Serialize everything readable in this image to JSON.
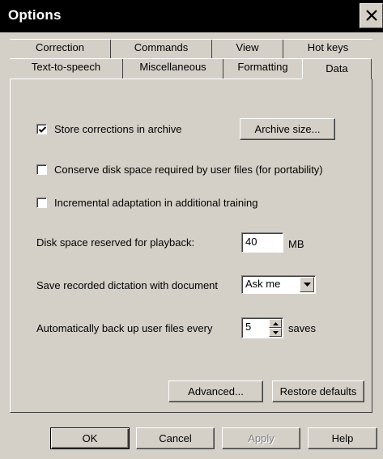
{
  "window": {
    "title": "Options",
    "close_icon": "close-icon"
  },
  "tabs": {
    "row_back": [
      "Correction",
      "Commands",
      "View",
      "Hot keys"
    ],
    "row_front": [
      "Text-to-speech",
      "Miscellaneous",
      "Formatting"
    ],
    "active": "Data"
  },
  "data_tab": {
    "store_corrections": {
      "label": "Store corrections in archive",
      "checked": true
    },
    "archive_size_button": "Archive size...",
    "conserve_disk": {
      "label": "Conserve disk space required by user files (for portability)",
      "checked": false
    },
    "incremental_adaptation": {
      "label": "Incremental adaptation in additional training",
      "checked": false
    },
    "disk_space": {
      "label": "Disk space reserved for playback:",
      "value": "40",
      "unit": "MB"
    },
    "save_dictation": {
      "label": "Save recorded dictation with document",
      "selected": "Ask me"
    },
    "backup": {
      "label": "Automatically back up user files every",
      "value": "5",
      "unit": "saves"
    },
    "advanced_button": "Advanced...",
    "restore_defaults_button": "Restore defaults"
  },
  "footer": {
    "ok": "OK",
    "cancel": "Cancel",
    "apply": "Apply",
    "help": "Help"
  },
  "colors": {
    "face": "#d4d0c8",
    "title_bar": "#000000",
    "disabled_text": "#808080"
  }
}
